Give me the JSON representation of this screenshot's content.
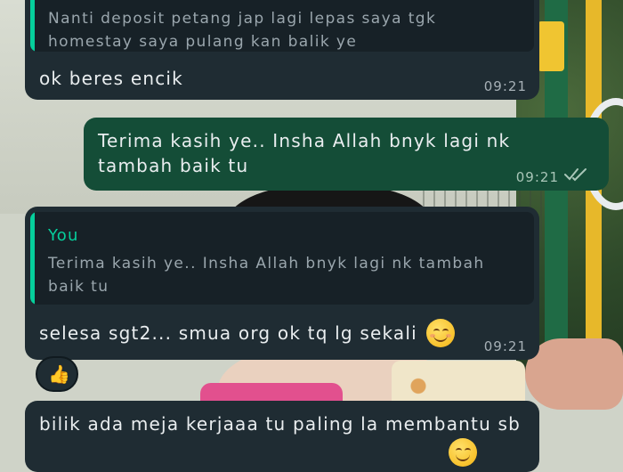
{
  "messages": [
    {
      "id": "m1",
      "direction": "incoming",
      "quoted_text": "Nanti deposit petang jap lagi lepas saya tgk\nhomestay saya pulang kan balik ye",
      "text": "ok beres encik",
      "time": "09:21"
    },
    {
      "id": "m2",
      "direction": "outgoing",
      "text": "Terima kasih ye.. Insha Allah bnyk lagi nk\ntambah baik tu",
      "time": "09:21",
      "status": "read"
    },
    {
      "id": "m3",
      "direction": "incoming",
      "quoted_author": "You",
      "quoted_text": "Terima kasih ye.. Insha Allah bnyk lagi nk tambah\nbaik tu",
      "text": "selesa sgt2... smua org ok tq lg sekali",
      "emoji": "smiling-face-icon",
      "time": "09:21",
      "reaction": "👍"
    },
    {
      "id": "m4",
      "direction": "incoming",
      "text": "bilik ada meja kerjaaa tu paling la membantu sb"
    }
  ],
  "colors": {
    "incoming_bubble": "#1f2c33",
    "outgoing_bubble": "#144d37",
    "quote_accent": "#06cf9c",
    "read_ticks": "#a9c6b8"
  }
}
